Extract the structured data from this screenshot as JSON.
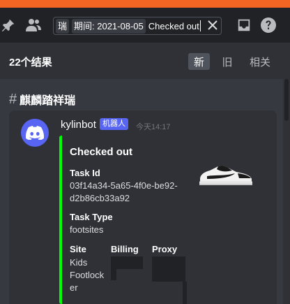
{
  "colors": {
    "accent_bar": "#f26522",
    "blurple": "#5865f2",
    "embed_border": "#00ff00",
    "background": "#36393f"
  },
  "toolbar": {
    "icons": [
      "pin-icon",
      "members-icon",
      "inbox-icon",
      "help-icon"
    ],
    "search": {
      "chip_channel": "瑞",
      "chip_during": "期间: 2021-08-05",
      "query": "Checked out"
    }
  },
  "results": {
    "count_label": "22个结果",
    "sort_tabs": [
      {
        "label": "新",
        "active": true
      },
      {
        "label": "旧",
        "active": false
      },
      {
        "label": "相关",
        "active": false
      }
    ]
  },
  "channel": {
    "hash": "#",
    "name": "麒麟踏祥瑞"
  },
  "message": {
    "author": "kylinbot",
    "badge": "机器人",
    "timestamp": "今天14:17",
    "embed": {
      "title": "Checked out",
      "task_id_label": "Task Id",
      "task_id_line1": "03f14a34-5a65-4f0e-be92-",
      "task_id_line2": "d2b86cb33a92",
      "task_type_label": "Task Type",
      "task_type_value": "footsites",
      "site_label": "Site",
      "site_line1": "Kids",
      "site_line2": "Footlock",
      "site_line3": "er",
      "billing_label": "Billing",
      "proxy_label": "Proxy",
      "thumbnail": "sneaker-thumbnail"
    }
  }
}
